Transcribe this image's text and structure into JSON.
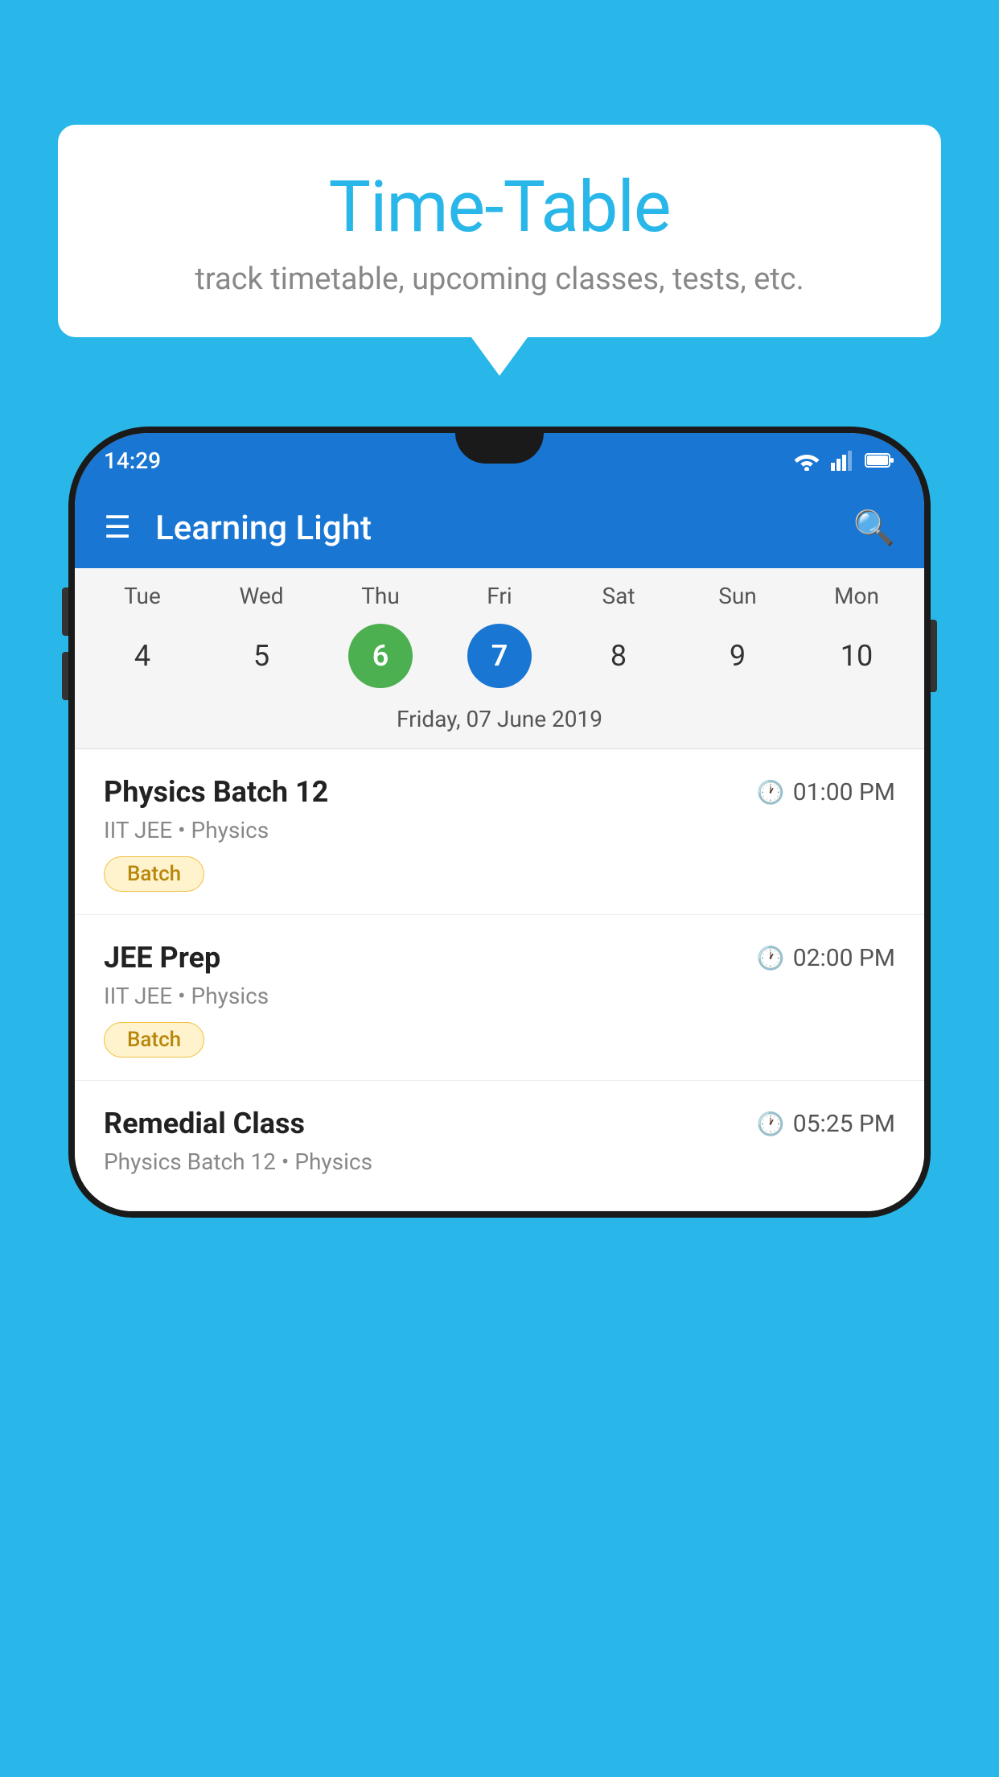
{
  "background": {
    "color": "#29b6e8"
  },
  "bubble": {
    "title": "Time-Table",
    "subtitle": "track timetable, upcoming classes, tests, etc."
  },
  "phone": {
    "status_bar": {
      "time": "14:29"
    },
    "app_bar": {
      "title": "Learning Light"
    },
    "calendar": {
      "days": [
        {
          "name": "Tue",
          "num": "4",
          "state": "normal"
        },
        {
          "name": "Wed",
          "num": "5",
          "state": "normal"
        },
        {
          "name": "Thu",
          "num": "6",
          "state": "today"
        },
        {
          "name": "Fri",
          "num": "7",
          "state": "selected"
        },
        {
          "name": "Sat",
          "num": "8",
          "state": "normal"
        },
        {
          "name": "Sun",
          "num": "9",
          "state": "normal"
        },
        {
          "name": "Mon",
          "num": "10",
          "state": "normal"
        }
      ],
      "selected_date_label": "Friday, 07 June 2019"
    },
    "schedule": [
      {
        "title": "Physics Batch 12",
        "time": "01:00 PM",
        "subtitle": "IIT JEE • Physics",
        "tag": "Batch"
      },
      {
        "title": "JEE Prep",
        "time": "02:00 PM",
        "subtitle": "IIT JEE • Physics",
        "tag": "Batch"
      },
      {
        "title": "Remedial Class",
        "time": "05:25 PM",
        "subtitle": "Physics Batch 12 • Physics",
        "tag": ""
      }
    ]
  }
}
